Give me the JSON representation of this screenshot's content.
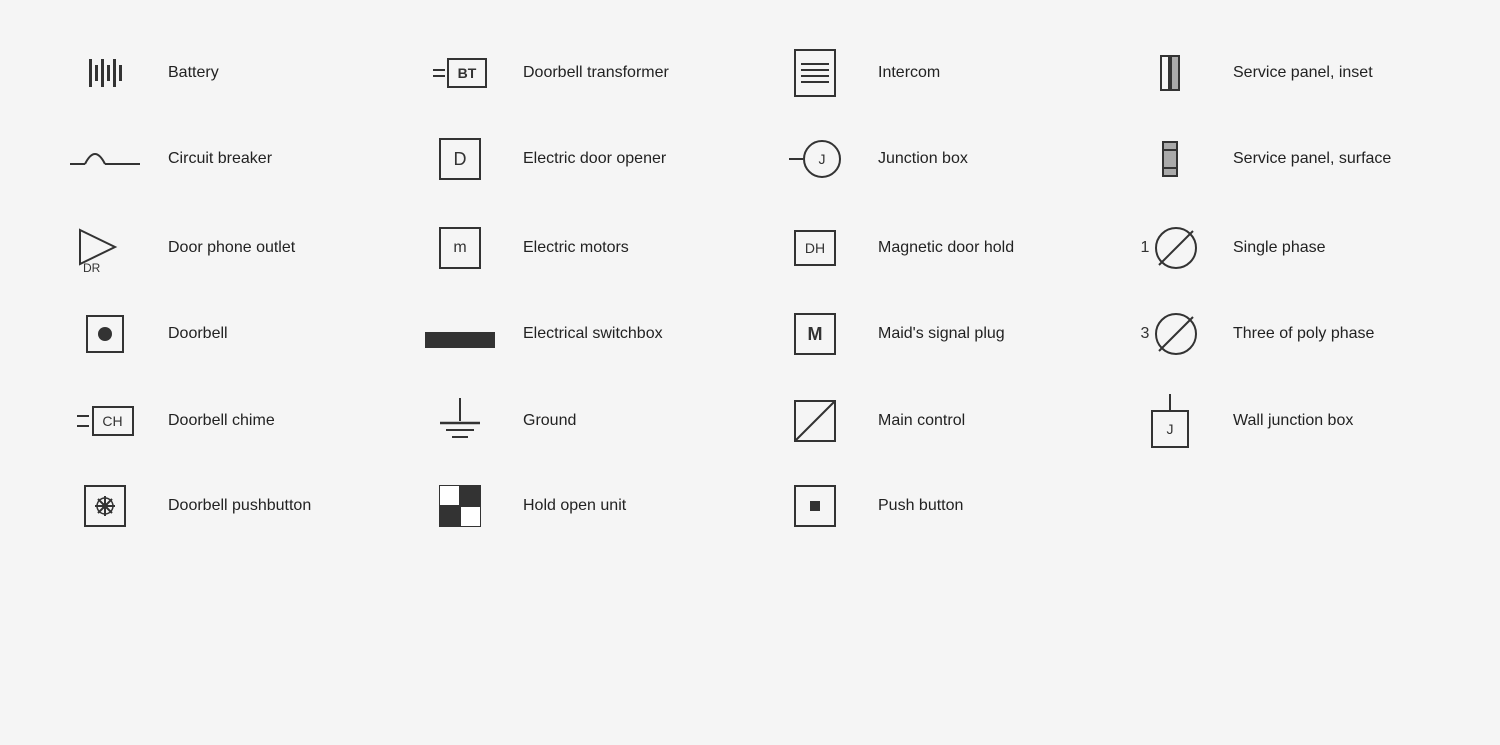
{
  "items": [
    {
      "id": "battery",
      "label": "Battery"
    },
    {
      "id": "doorbell-transformer",
      "label": "Doorbell transformer"
    },
    {
      "id": "intercom",
      "label": "Intercom"
    },
    {
      "id": "service-panel-inset",
      "label": "Service panel, inset"
    },
    {
      "id": "circuit-breaker",
      "label": "Circuit breaker"
    },
    {
      "id": "electric-door-opener",
      "label": "Electric door opener"
    },
    {
      "id": "junction-box",
      "label": "Junction box"
    },
    {
      "id": "service-panel-surface",
      "label": "Service panel, surface"
    },
    {
      "id": "door-phone-outlet",
      "label": "Door phone outlet"
    },
    {
      "id": "electric-motors",
      "label": "Electric motors"
    },
    {
      "id": "magnetic-door-hold",
      "label": "Magnetic door hold"
    },
    {
      "id": "single-phase",
      "label": "Single phase"
    },
    {
      "id": "doorbell",
      "label": "Doorbell"
    },
    {
      "id": "electrical-switchbox",
      "label": "Electrical switchbox"
    },
    {
      "id": "maids-signal-plug",
      "label": "Maid's signal plug"
    },
    {
      "id": "three-poly-phase",
      "label": "Three of poly phase"
    },
    {
      "id": "doorbell-chime",
      "label": "Doorbell chime"
    },
    {
      "id": "ground",
      "label": "Ground"
    },
    {
      "id": "main-control",
      "label": "Main control"
    },
    {
      "id": "wall-junction-box",
      "label": "Wall junction box"
    },
    {
      "id": "doorbell-pushbutton",
      "label": "Doorbell pushbutton"
    },
    {
      "id": "hold-open-unit",
      "label": "Hold open unit"
    },
    {
      "id": "push-button",
      "label": "Push button"
    },
    {
      "id": "empty",
      "label": ""
    }
  ]
}
